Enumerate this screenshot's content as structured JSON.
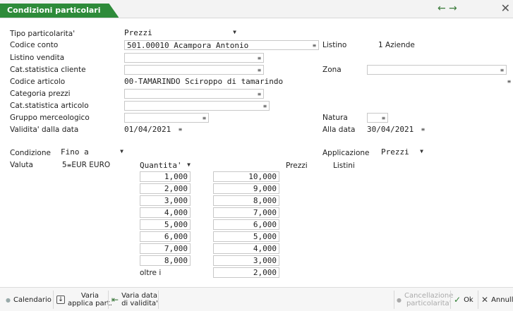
{
  "window": {
    "title": "Condizioni particolari"
  },
  "form": {
    "tipo_label": "Tipo particolarita'",
    "tipo_value": "Prezzi",
    "codice_conto_label": "Codice conto",
    "codice_conto_value": "501.00010 Acampora Antonio",
    "listino_label": "Listino",
    "listino_value": "1 Aziende",
    "listino_vendita_label": "Listino vendita",
    "cat_cliente_label": "Cat.statistica cliente",
    "zona_label": "Zona",
    "codice_articolo_label": "Codice articolo",
    "codice_articolo_value": "00-TAMARINDO Sciroppo di tamarindo",
    "categoria_prezzi_label": "Categoria prezzi",
    "cat_articolo_label": "Cat.statistica articolo",
    "gruppo_label": "Gruppo merceologico",
    "natura_label": "Natura",
    "validita_label": "Validita' dalla data",
    "validita_value": "01/04/2021",
    "alla_data_label": "Alla data",
    "alla_data_value": "30/04/2021",
    "condizione_label": "Condizione",
    "condizione_value": "Fino a",
    "applicazione_label": "Applicazione",
    "applicazione_value": "Prezzi",
    "valuta_label": "Valuta",
    "valuta_code": "5",
    "valuta_value": "EUR EURO",
    "quantita_header": "Quantita'",
    "prezzi_header": "Prezzi",
    "listini_header": "Listini",
    "oltre_label": "oltre i"
  },
  "quantities": [
    "1,000",
    "2,000",
    "3,000",
    "4,000",
    "5,000",
    "6,000",
    "7,000",
    "8,000"
  ],
  "prices": [
    "10,000",
    "9,000",
    "8,000",
    "7,000",
    "6,000",
    "5,000",
    "4,000",
    "3,000",
    "2,000"
  ],
  "toolbar": {
    "calendario": "Calendario",
    "varia_applica_1": "Varia",
    "varia_applica_2": "applica part.",
    "varia_data_1": "Varia data",
    "varia_data_2": "di validita'",
    "cancellazione_1": "Cancellazione",
    "cancellazione_2": "particolarita'",
    "ok": "Ok",
    "annulla": "Annull"
  }
}
